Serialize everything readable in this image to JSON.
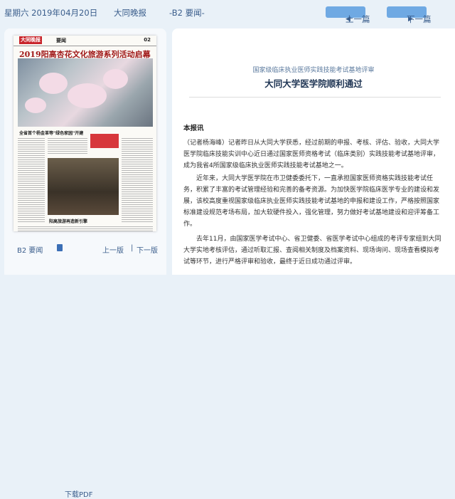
{
  "header": {
    "date": "星期六 2019年04月20日",
    "paper_name": "大同晚报",
    "section": "-B2 要闻-",
    "prev_label": "上一篇",
    "next_label": "下一篇"
  },
  "thumbnail": {
    "masthead_logo": "大同晚报",
    "masthead_section": "要闻",
    "page_number": "02",
    "headline": "2019阳高杏花文化旅游系列活动启幕",
    "subhead_1": "全省首个杨金革等\"绿色家园\"开建",
    "subhead_2": "阳高旅游再造新引擎"
  },
  "bottom_nav": {
    "page_link": "B2 要闻",
    "download_pdf": "下载PDF",
    "prev_page": "上一版",
    "next_page": "下一版"
  },
  "article": {
    "subtitle": "国家级临床执业医师实践技能考试基地评审",
    "title": "大同大学医学院顺利通过",
    "lead": "本报讯",
    "paragraphs": [
      [
        "（记者杨海峰）记者昨日从大同大学获悉，经过前期的申报、考核、评估、验收，大同大学",
        "医学院临床技能实训中心近日通过国家医师资格考试（临床类别）实践技能考试基地评审，",
        "成为我省4所国家级临床执业医师实践技能考试基地之一。"
      ],
      [
        "　　近年来，大同大学医学院在市卫健委委托下，一直承担国家医师资格实践技能考试任",
        "务，积累了丰富的考试管理经验和完善的备考资源。为加快医学院临床医学专业的建设和发",
        "展，该校高度重视国家级临床执业医师实践技能考试基地的申报和建设工作，严格按照国家",
        "标准建设规范考场布局，加大软硬件投入，强化管理，努力做好考试基地建设和迎评筹备工",
        "作。"
      ],
      [
        "　　去年11月，由国家医学考试中心、省卫健委、省医学考试中心组成的考评专家组到大同",
        "大学实地考核评估，通过听取汇报、查阅相关制度及档案资料、现场询问、现场查看模拟考",
        "试等环节，进行严格评审和验收，最终于近日成功通过评审。"
      ]
    ]
  },
  "colors": {
    "accent_blue": "#6fa9e3",
    "title_navy": "#1f3554",
    "headline_red": "#a01818",
    "background": "#e9f1f8"
  }
}
